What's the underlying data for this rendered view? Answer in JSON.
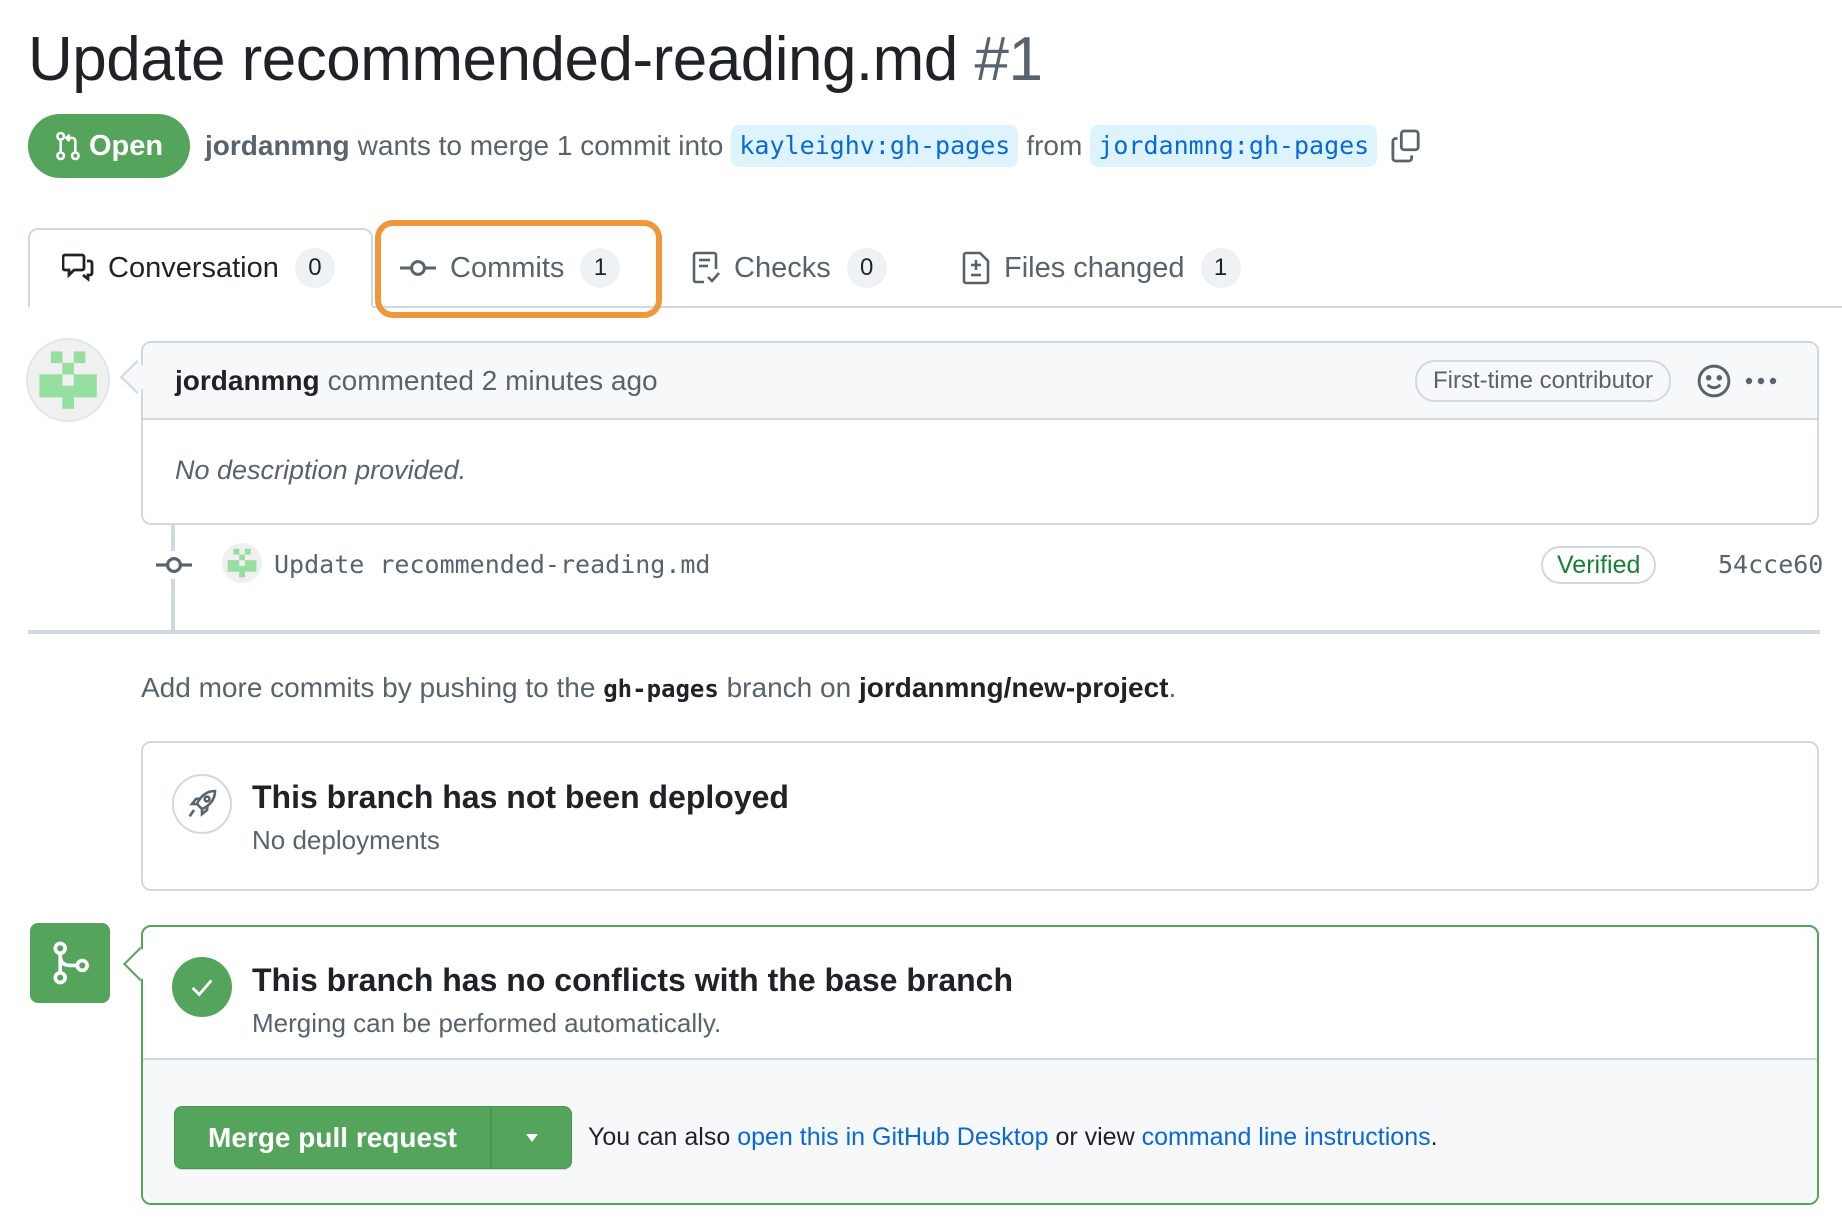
{
  "header": {
    "title": "Update recommended-reading.md",
    "number": "#1",
    "state_label": "Open",
    "author": "jordanmng",
    "merge_text": "wants to merge 1 commit into",
    "base_branch": "kayleighv:gh-pages",
    "from_text": "from",
    "head_branch": "jordanmng:gh-pages"
  },
  "tabs": [
    {
      "label": "Conversation",
      "count": "0",
      "icon": "comment-discussion-icon",
      "active": true
    },
    {
      "label": "Commits",
      "count": "1",
      "icon": "git-commit-icon",
      "highlighted": true
    },
    {
      "label": "Checks",
      "count": "0",
      "icon": "checklist-icon"
    },
    {
      "label": "Files changed",
      "count": "1",
      "icon": "file-diff-icon"
    }
  ],
  "comment": {
    "author": "jordanmng",
    "action": "commented 2 minutes ago",
    "badge": "First-time contributor",
    "body": "No description provided."
  },
  "commit": {
    "message": "Update recommended-reading.md",
    "verified_label": "Verified",
    "sha": "54cce60"
  },
  "push_hint": {
    "prefix": "Add more commits by pushing to the",
    "branch": "gh-pages",
    "middle": "branch on",
    "repo": "jordanmng/new-project",
    "suffix": "."
  },
  "deploy": {
    "title": "This branch has not been deployed",
    "subtitle": "No deployments"
  },
  "merge": {
    "title": "This branch has no conflicts with the base branch",
    "subtitle": "Merging can be performed automatically.",
    "button_label": "Merge pull request",
    "hint_prefix": "You can also",
    "desktop_link": "open this in GitHub Desktop",
    "hint_middle": "or view",
    "cli_link": "command line instructions",
    "hint_suffix": "."
  },
  "colors": {
    "open_green": "#55a45b",
    "link_blue": "#0969da",
    "highlight_orange": "#f0973a",
    "identicon_green": "#95e0a0"
  }
}
